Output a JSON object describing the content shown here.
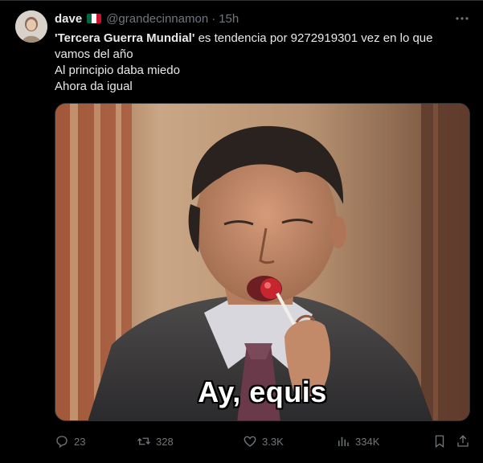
{
  "tweet": {
    "author": {
      "display_name": "dave",
      "handle": "@grandecinnamon",
      "separator": "·",
      "time": "15h",
      "flag_icon": "mexico-flag-icon"
    },
    "text": {
      "bold_part": "'Tercera Guerra Mundial'",
      "line1_rest": " es tendencia por 9272919301 vez en lo que",
      "line2": "vamos del año",
      "line3": "Al principio daba miedo",
      "line4": "Ahora da igual"
    },
    "media": {
      "caption": "Ay, equis"
    },
    "actions": {
      "replies": "23",
      "reposts": "328",
      "likes": "3.3K",
      "views": "334K"
    }
  },
  "colors": {
    "background": "#000000",
    "text_primary": "#e7e9ea",
    "text_secondary": "#71767b",
    "border": "#2f3336"
  }
}
